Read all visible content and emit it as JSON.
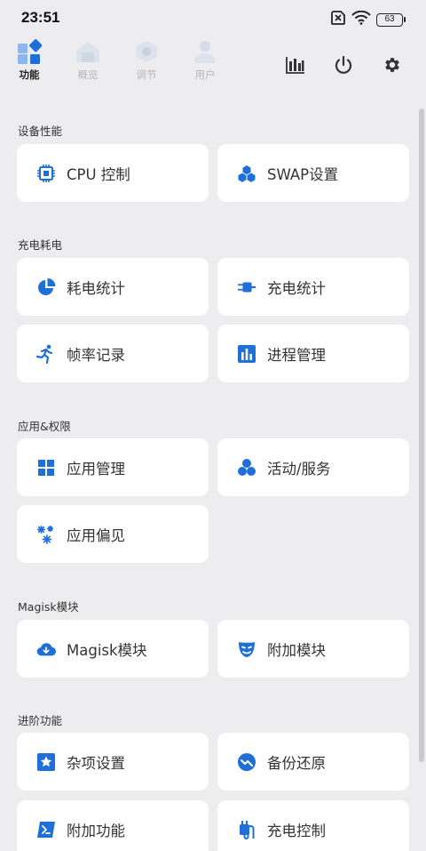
{
  "status": {
    "time": "23:51",
    "battery": "63"
  },
  "nav": {
    "tabs": [
      {
        "label": "功能",
        "active": true
      },
      {
        "label": "概览",
        "active": false
      },
      {
        "label": "调节",
        "active": false
      },
      {
        "label": "用户",
        "active": false
      }
    ]
  },
  "sections": [
    {
      "title": "设备性能",
      "items": [
        {
          "label": "CPU 控制",
          "icon": "cpu-icon"
        },
        {
          "label": "SWAP设置",
          "icon": "swap-icon"
        }
      ]
    },
    {
      "title": "充电耗电",
      "items": [
        {
          "label": "耗电统计",
          "icon": "pie-icon"
        },
        {
          "label": "充电统计",
          "icon": "plug-icon"
        },
        {
          "label": "帧率记录",
          "icon": "running-icon"
        },
        {
          "label": "进程管理",
          "icon": "bar-chart-icon"
        }
      ]
    },
    {
      "title": "应用&权限",
      "items": [
        {
          "label": "应用管理",
          "icon": "grid-icon"
        },
        {
          "label": "活动/服务",
          "icon": "bubbles-icon"
        },
        {
          "label": "应用偏见",
          "icon": "snowflake-icon"
        }
      ]
    },
    {
      "title": "Magisk模块",
      "items": [
        {
          "label": "Magisk模块",
          "icon": "cloud-download-icon"
        },
        {
          "label": "附加模块",
          "icon": "mask-icon"
        }
      ]
    },
    {
      "title": "进阶功能",
      "items": [
        {
          "label": "杂项设置",
          "icon": "star-icon"
        },
        {
          "label": "备份还原",
          "icon": "chart-circle-icon"
        },
        {
          "label": "附加功能",
          "icon": "terminal-icon"
        },
        {
          "label": "充电控制",
          "icon": "charger-icon"
        }
      ]
    }
  ],
  "colors": {
    "accent": "#1E6FD9",
    "background": "#EDECEE",
    "card": "#FFFFFF"
  }
}
